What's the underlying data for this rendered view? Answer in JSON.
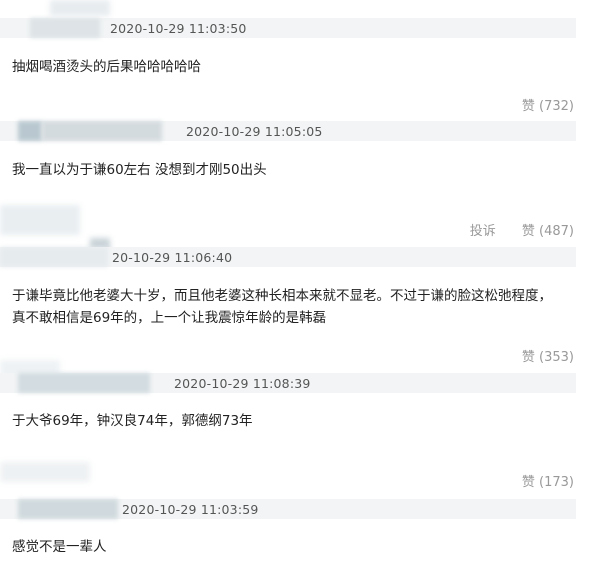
{
  "comments": [
    {
      "time": "2020-10-29 11:03:50",
      "text": "抽烟喝酒烫头的后果哈哈哈哈哈",
      "like": "赞 (732)"
    },
    {
      "time": "2020-10-29 11:05:05",
      "text": "我一直以为于谦60左右 没想到才刚50出头",
      "report": "投诉",
      "like": "赞 (487)"
    },
    {
      "time": "20-10-29 11:06:40",
      "text_lines": [
        "于谦毕竟比他老婆大十岁，而且他老婆这种长相本来就不显老。不过于谦的脸这松弛程度，",
        "真不敢相信是69年的，上一个让我震惊年龄的是韩磊"
      ],
      "like": "赞 (353)"
    },
    {
      "time": "2020-10-29 11:08:39",
      "text": "于大爷69年，钟汉良74年，郭德纲73年",
      "like": "赞 (173)"
    },
    {
      "time": "2020-10-29 11:03:59",
      "text": "感觉不是一辈人"
    }
  ]
}
